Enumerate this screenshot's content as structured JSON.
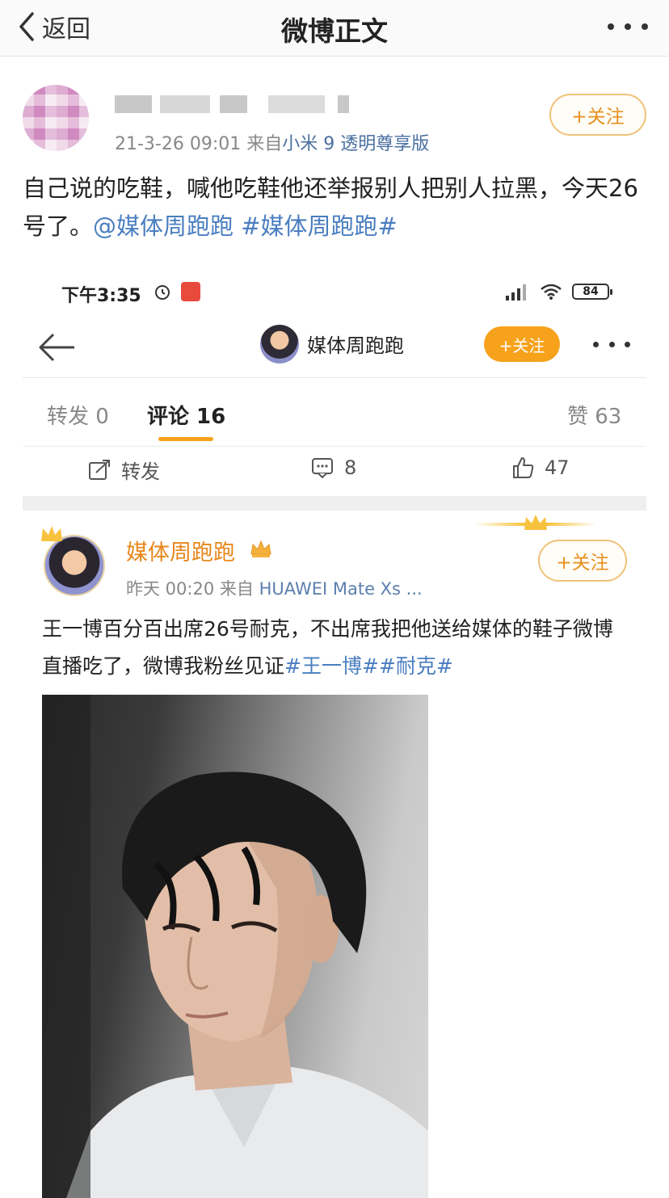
{
  "topbar": {
    "back_label": "返回",
    "title": "微博正文"
  },
  "outer_post": {
    "meta_time": "21-3-26 09:01",
    "meta_from": "来自",
    "meta_source": "小米 9 透明尊享版",
    "follow_label": "+关注",
    "text_plain": "自己说的吃鞋，喊他吃鞋他还举报别人把别人拉黑，今天26号了。",
    "text_mention": "@媒体周跑跑",
    "text_tag": "#媒体周跑跑#"
  },
  "screenshot": {
    "status": {
      "time": "下午3:35",
      "battery": "84"
    },
    "nav": {
      "name": "媒体周跑跑",
      "follow_label": "+关注"
    },
    "tabs": [
      {
        "label": "转发 0"
      },
      {
        "label": "评论 16"
      },
      {
        "label": "赞 63"
      }
    ],
    "actions": {
      "repost": "转发",
      "comments": "8",
      "likes": "47"
    },
    "original": {
      "name": "媒体周跑跑",
      "time": "昨天 00:20",
      "from": "来自",
      "device": "HUAWEI Mate Xs ...",
      "follow_label": "+关注",
      "text_plain": "王一博百分百出席26号耐克，不出席我把他送给媒体的鞋子微博直播吃了，微博我粉丝见证",
      "text_tags": "#王一博##耐克#"
    }
  },
  "colors": {
    "accent_orange": "#f7a21b",
    "link_blue": "#4a7ec0",
    "vip_name": "#e8861a"
  }
}
